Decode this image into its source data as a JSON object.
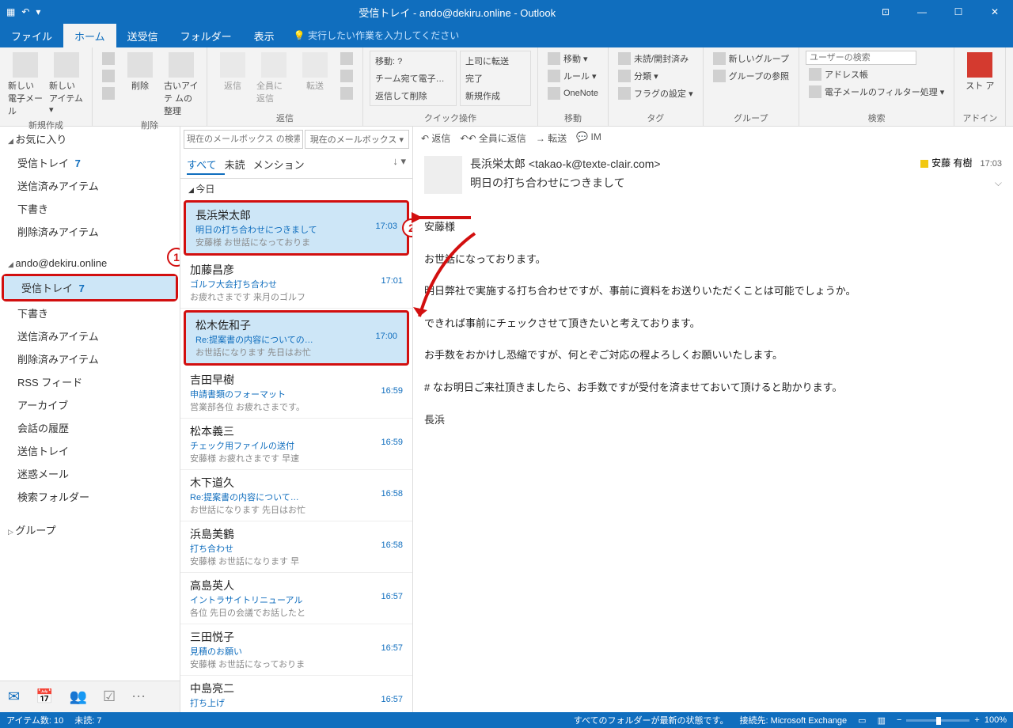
{
  "title": "受信トレイ - ando@dekiru.online - Outlook",
  "menu": {
    "file": "ファイル",
    "home": "ホーム",
    "sendrecv": "送受信",
    "folder": "フォルダー",
    "view": "表示",
    "tell": "実行したい作業を入力してください"
  },
  "ribbon": {
    "new": {
      "mail": "新しい\n電子メール",
      "items": "新しい\nアイテム ▾",
      "label": "新規作成"
    },
    "del": {
      "delete": "削除",
      "archive": "古いアイテ\nムの整理",
      "label": "削除"
    },
    "reply": {
      "reply": "返信",
      "replyall": "全員に\n返信",
      "forward": "転送",
      "label": "返信"
    },
    "quick": {
      "move": "移動: ?",
      "team": "チーム宛て電子…",
      "replydel": "返信して削除",
      "boss": "上司に転送",
      "done": "完了",
      "newcreate": "新規作成",
      "label": "クイック操作"
    },
    "move": {
      "move": "移動 ▾",
      "rules": "ルール ▾",
      "onenote": "OneNote",
      "label": "移動"
    },
    "tags": {
      "unread": "未読/開封済み",
      "cat": "分類 ▾",
      "flag": "フラグの設定 ▾",
      "label": "タグ"
    },
    "groups": {
      "new": "新しいグループ",
      "browse": "グループの参照",
      "label": "グループ"
    },
    "find": {
      "placeholder": "ユーザーの検索",
      "addr": "アドレス帳",
      "filter": "電子メールのフィルター処理 ▾",
      "label": "検索"
    },
    "addins": {
      "store": "スト\nア",
      "label": "アドイン"
    }
  },
  "nav": {
    "fav": "お気に入り",
    "fav_items": [
      {
        "label": "受信トレイ",
        "count": "7"
      },
      {
        "label": "送信済みアイテム"
      },
      {
        "label": "下書き"
      },
      {
        "label": "削除済みアイテム"
      }
    ],
    "account": "ando@dekiru.online",
    "acc_items": [
      {
        "label": "受信トレイ",
        "count": "7",
        "hi": true
      },
      {
        "label": "下書き"
      },
      {
        "label": "送信済みアイテム"
      },
      {
        "label": "削除済みアイテム"
      },
      {
        "label": "RSS フィード"
      },
      {
        "label": "アーカイブ"
      },
      {
        "label": "会話の履歴"
      },
      {
        "label": "送信トレイ"
      },
      {
        "label": "迷惑メール"
      },
      {
        "label": "検索フォルダー"
      }
    ],
    "groups": "グループ"
  },
  "mlist": {
    "search_ph": "現在のメールボックス の検索",
    "scope": "現在のメールボックス ▾",
    "filters": {
      "all": "すべて",
      "unread": "未読",
      "mention": "メンション"
    },
    "date": "今日",
    "items": [
      {
        "from": "長浜栄太郎",
        "subj": "明日の打ち合わせにつきまして",
        "prev": "安藤様  お世話になっておりま",
        "time": "17:03",
        "sel": true,
        "hi": true,
        "badge": "2"
      },
      {
        "from": "加藤昌彦",
        "subj": "ゴルフ大会打ち合わせ",
        "prev": "お疲れさまです  来月のゴルフ",
        "time": "17:01"
      },
      {
        "from": "松木佐和子",
        "subj": "Re:提案書の内容についての…",
        "prev": "お世話になります  先日はお忙",
        "time": "17:00",
        "sel": true,
        "hi": true
      },
      {
        "from": "吉田早樹",
        "subj": "申請書類のフォーマット",
        "prev": "営業部各位  お疲れさまです。",
        "time": "16:59"
      },
      {
        "from": "松本義三",
        "subj": "チェック用ファイルの送付",
        "prev": "安藤様  お疲れさまです  早速",
        "time": "16:59"
      },
      {
        "from": "木下道久",
        "subj": "Re:提案書の内容について…",
        "prev": "お世話になります  先日はお忙",
        "time": "16:58"
      },
      {
        "from": "浜島美鶴",
        "subj": "打ち合わせ",
        "prev": "安藤様  お世話になります  早",
        "time": "16:58"
      },
      {
        "from": "高島英人",
        "subj": "イントラサイトリニューアル",
        "prev": "各位  先日の会議でお話したと",
        "time": "16:57"
      },
      {
        "from": "三田悦子",
        "subj": "見積のお願い",
        "prev": "安藤様  お世話になっておりま",
        "time": "16:57"
      },
      {
        "from": "中島亮二",
        "subj": "打ち上げ",
        "prev": "",
        "time": "16:57"
      }
    ]
  },
  "reader": {
    "actions": {
      "reply": "返信",
      "replyall": "全員に返信",
      "forward": "転送",
      "im": "IM"
    },
    "from": "長浜栄太郎 <takao-k@texte-clair.com>",
    "category": "安藤 有樹",
    "subject": "明日の打ち合わせにつきまして",
    "time": "17:03",
    "body": [
      "安藤様",
      "お世話になっております。",
      "明日弊社で実施する打ち合わせですが、事前に資料をお送りいただくことは可能でしょうか。",
      "できれば事前にチェックさせて頂きたいと考えております。",
      "お手数をおかけし恐縮ですが、何とぞご対応の程よろしくお願いいたします。",
      "#  なお明日ご来社頂きましたら、お手数ですが受付を済ませておいて頂けると助かります。",
      "長浜"
    ]
  },
  "status": {
    "items": "アイテム数: 10",
    "unread": "未読: 7",
    "folders": "すべてのフォルダーが最新の状態です。",
    "conn": "接続先: Microsoft Exchange",
    "zoom": "100%"
  }
}
